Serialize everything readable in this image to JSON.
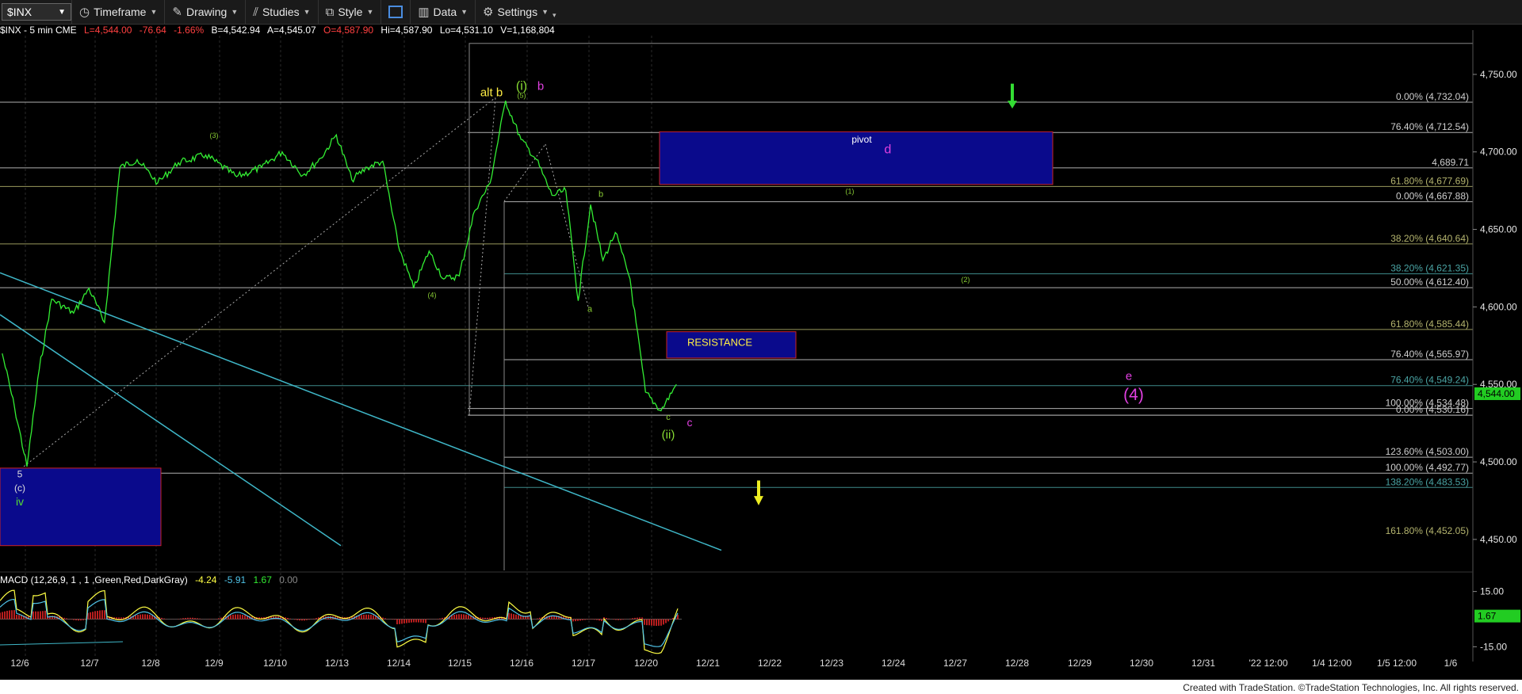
{
  "toolbar": {
    "symbol": "$INX",
    "items": [
      {
        "label": "Timeframe",
        "icon": "clock-icon"
      },
      {
        "label": "Drawing",
        "icon": "pencil-icon"
      },
      {
        "label": "Studies",
        "icon": "studies-icon"
      },
      {
        "label": "Style",
        "icon": "style-icon"
      },
      {
        "label": "",
        "icon": "layout-icon"
      },
      {
        "label": "Data",
        "icon": "data-icon"
      },
      {
        "label": "Settings",
        "icon": "gear-icon"
      }
    ]
  },
  "info": {
    "name": "$INX - 5 min  CME",
    "last": "L=4,544.00",
    "change": "-76.64",
    "pct": "-1.66%",
    "bid": "B=4,542.94",
    "ask": "A=4,545.07",
    "open": "O=4,587.90",
    "high": "Hi=4,587.90",
    "low": "Lo=4,531.10",
    "volume": "V=1,168,804"
  },
  "macd": {
    "label": "MACD (12,26,9, 1 , 1 ,Green,Red,DarkGray)",
    "v1": "-4.24",
    "v2": "-5.91",
    "v3": "1.67",
    "v4": "0.00",
    "ticks": [
      "15.00",
      "-15.00"
    ],
    "last": "1.67"
  },
  "colors": {
    "price": "#33ee33",
    "fib_white": "#cfcfcf",
    "fib_olive": "#b4b46e",
    "fib_teal": "#4aa4a4",
    "trend": "#3fb7c8",
    "box": "#0a0a8c",
    "box_border": "#cc2222",
    "yellow": "#ffff33",
    "magenta": "#e040e0",
    "green_label": "#44dd44"
  },
  "chart_data": {
    "type": "line",
    "title": "$INX - 5 min",
    "ylim": [
      4430,
      4775
    ],
    "price_ticks": [
      "4,750.00",
      "4,700.00",
      "4,650.00",
      "4,600.00",
      "4,550.00",
      "4,500.00",
      "4,450.00"
    ],
    "last_price": "4,544.00",
    "dates": [
      "12/6",
      "12/7",
      "12/8",
      "12/9",
      "12/10",
      "12/13",
      "12/14",
      "12/15",
      "12/16",
      "12/17",
      "12/20",
      "12/21",
      "12/22",
      "12/23",
      "12/24",
      "12/27",
      "12/28",
      "12/29",
      "12/30",
      "12/31",
      "'22 12:00",
      "1/4 12:00",
      "1/5 12:00",
      "1/6"
    ],
    "series": [
      {
        "x": [
          "12/6",
          "12/6",
          "12/6",
          "12/6",
          "12/6",
          "12/7",
          "12/7",
          "12/7",
          "12/7",
          "12/8",
          "12/8",
          "12/8",
          "12/9",
          "12/9",
          "12/10",
          "12/10",
          "12/10",
          "12/13",
          "12/13",
          "12/13",
          "12/13",
          "12/14",
          "12/14",
          "12/14",
          "12/14",
          "12/15",
          "12/15",
          "12/15",
          "12/15",
          "12/16",
          "12/16",
          "12/16",
          "12/16",
          "12/17",
          "12/17",
          "12/17",
          "12/17",
          "12/17",
          "12/20",
          "12/20",
          "12/20",
          "12/20"
        ],
        "values": [
          4570,
          4535,
          4497,
          4560,
          4605,
          4596,
          4612,
          4590,
          4690,
          4695,
          4680,
          4693,
          4698,
          4684,
          4690,
          4700,
          4685,
          4696,
          4711,
          4682,
          4690,
          4694,
          4640,
          4612,
          4636,
          4618,
          4620,
          4662,
          4680,
          4733,
          4708,
          4695,
          4672,
          4675,
          4604,
          4666,
          4630,
          4648,
          4618,
          4545,
          4533,
          4550
        ]
      }
    ],
    "fib_levels": [
      {
        "label": "0.00% (4,732.04)",
        "value": 4732.04
      },
      {
        "label": "76.40% (4,712.54)",
        "value": 4712.54
      },
      {
        "label": "4,689.71",
        "value": 4689.71
      },
      {
        "label": "61.80% (4,677.69)",
        "value": 4677.69
      },
      {
        "label": "0.00% (4,667.88)",
        "value": 4667.88
      },
      {
        "label": "38.20% (4,640.64)",
        "value": 4640.64
      },
      {
        "label": "38.20% (4,621.35)",
        "value": 4621.35
      },
      {
        "label": "50.00% (4,612.40)",
        "value": 4612.4
      },
      {
        "label": "61.80% (4,585.44)",
        "value": 4585.44
      },
      {
        "label": "76.40% (4,565.97)",
        "value": 4565.97
      },
      {
        "label": "76.40% (4,549.24)",
        "value": 4549.24
      },
      {
        "label": "100.00% (4,534.48)",
        "value": 4534.48
      },
      {
        "label": "0.00% (4,530.16)",
        "value": 4530.16
      },
      {
        "label": "123.60% (4,503.00)",
        "value": 4503.0
      },
      {
        "label": "100.00% (4,492.77)",
        "value": 4492.77
      },
      {
        "label": "138.20% (4,483.53)",
        "value": 4483.53
      },
      {
        "label": "161.80% (4,452.05)",
        "value": 4452.05
      }
    ],
    "annotations": [
      {
        "text": "alt b",
        "x": "12/15",
        "y": 4736
      },
      {
        "text": "(i)",
        "x": "12/16",
        "y": 4740
      },
      {
        "text": "b",
        "x": "12/16",
        "y": 4740
      },
      {
        "text": "(5)",
        "x": "12/16",
        "y": 4735
      },
      {
        "text": "(3)",
        "x": "12/9",
        "y": 4709
      },
      {
        "text": "b",
        "x": "12/17",
        "y": 4671
      },
      {
        "text": "(4)",
        "x": "12/14",
        "y": 4606
      },
      {
        "text": "a",
        "x": "12/17",
        "y": 4597
      },
      {
        "text": "c",
        "x": "12/20",
        "y": 4527
      },
      {
        "text": "c",
        "x": "12/20",
        "y": 4523
      },
      {
        "text": "(ii)",
        "x": "12/20",
        "y": 4515
      },
      {
        "text": "pivot",
        "x": "12/23",
        "y": 4706
      },
      {
        "text": "d",
        "x": "12/24",
        "y": 4699
      },
      {
        "text": "(1)",
        "x": "12/23",
        "y": 4673
      },
      {
        "text": "(2)",
        "x": "12/27",
        "y": 4616
      },
      {
        "text": "RESISTANCE",
        "x": "12/21",
        "y": 4575
      },
      {
        "text": "e",
        "x": "12/30",
        "y": 4553
      },
      {
        "text": "(4)",
        "x": "12/30",
        "y": 4540
      },
      {
        "text": "5",
        "x": "12/6",
        "y": 4490
      },
      {
        "text": "(c)",
        "x": "12/6",
        "y": 4481
      },
      {
        "text": "iv",
        "x": "12/6",
        "y": 4472
      }
    ]
  },
  "credit": "Created with TradeStation. ©TradeStation Technologies, Inc. All rights reserved."
}
